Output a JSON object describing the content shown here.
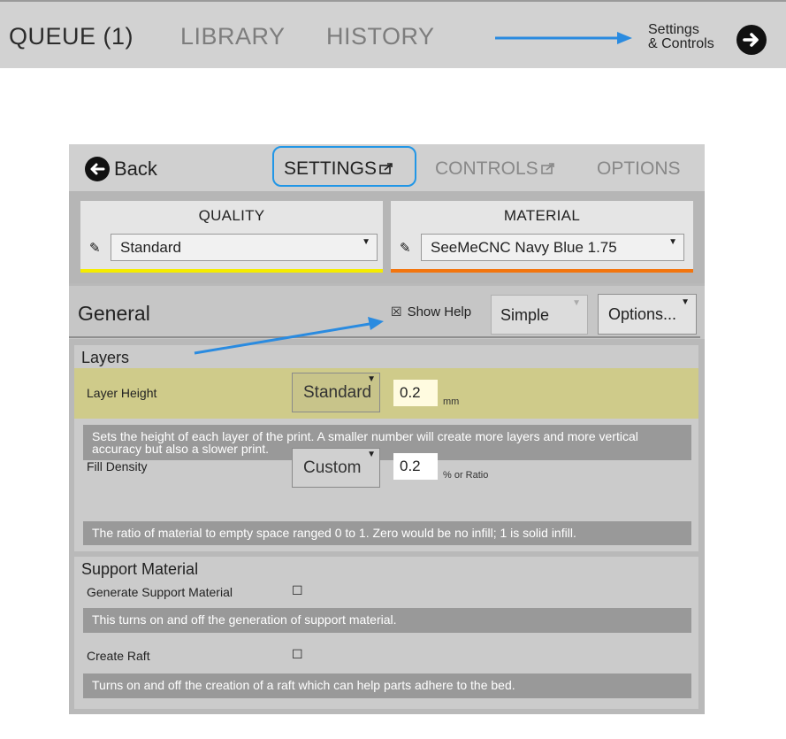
{
  "top_tabs": {
    "queue": "QUEUE (1)",
    "library": "LIBRARY",
    "history": "HISTORY",
    "settings_controls_line1": "Settings",
    "settings_controls_line2": "& Controls"
  },
  "panel": {
    "back_label": "Back",
    "tabs": {
      "settings": "SETTINGS",
      "controls": "CONTROLS",
      "options": "OPTIONS"
    },
    "quality": {
      "title": "QUALITY",
      "value": "Standard"
    },
    "material": {
      "title": "MATERIAL",
      "value": "SeeMeCNC Navy Blue 1.75"
    },
    "general": {
      "title": "General",
      "show_help_checkbox": "☒",
      "show_help_label": "Show Help",
      "mode": "Simple",
      "options_button": "Options..."
    },
    "layers": {
      "title": "Layers",
      "layer_height": {
        "label": "Layer Height",
        "preset": "Standard",
        "value": "0.2",
        "unit": "mm",
        "help": "Sets the height of each layer of the print. A smaller number will create more layers and more vertical accuracy but also a slower print."
      },
      "fill_density": {
        "label": "Fill Density",
        "preset": "Custom",
        "value": "0.2",
        "unit": "% or Ratio",
        "help": "The ratio of material to empty space ranged 0 to 1. Zero would be no infill; 1 is solid infill."
      }
    },
    "support": {
      "title": "Support Material",
      "generate_support": {
        "label": "Generate Support Material",
        "checkbox": "☐",
        "help": "This turns on and off the generation of support material."
      },
      "create_raft": {
        "label": "Create Raft",
        "checkbox": "☐",
        "help": "Turns on and off the creation of a raft which can help parts adhere to the bed."
      }
    }
  },
  "icons": {
    "forward_arrow": "arrow-right-circle-icon",
    "back_arrow": "arrow-left-circle-icon",
    "pencil": "pencil-icon",
    "external": "open-external-icon"
  },
  "colors": {
    "annotation_arrow": "#2a8be0",
    "quality_accent": "#f5ec00",
    "material_accent": "#f3750e",
    "highlight_row": "#cfcb8a"
  }
}
